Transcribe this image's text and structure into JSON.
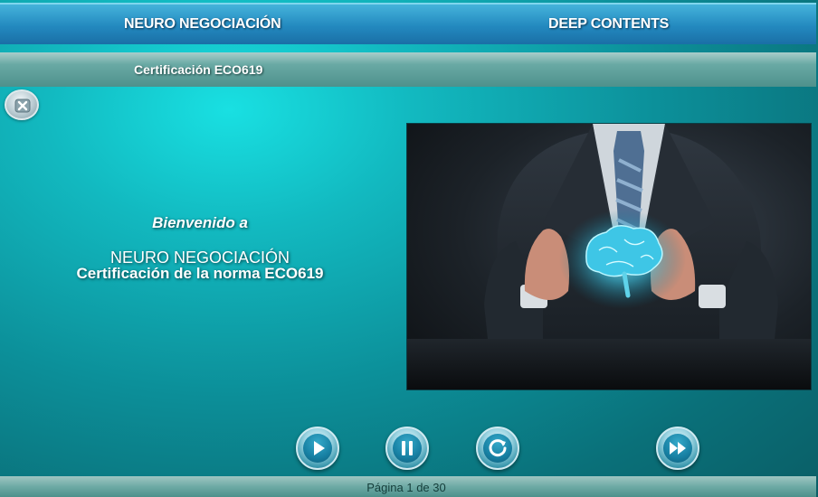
{
  "header": {
    "course_title": "NEURO NEGOCIACIÓN",
    "brand": "DEEP CONTENTS"
  },
  "subheader": {
    "module_title": "Certificación ECO619"
  },
  "welcome": {
    "greeting": "Bienvenido a",
    "course": "NEURO NEGOCIACIÓN",
    "certification": "Certificación de la norma ECO619"
  },
  "icons": {
    "close": "close-x-icon",
    "play": "play-icon",
    "pause": "pause-icon",
    "replay": "replay-icon",
    "next": "fast-forward-icon"
  },
  "footer": {
    "page_indicator": "Página 1 de 30"
  },
  "colors": {
    "header_blue": "#2389bf",
    "subbar_teal": "#69a9a4",
    "background_teal": "#0c8f99",
    "button_blue": "#1780a3"
  }
}
